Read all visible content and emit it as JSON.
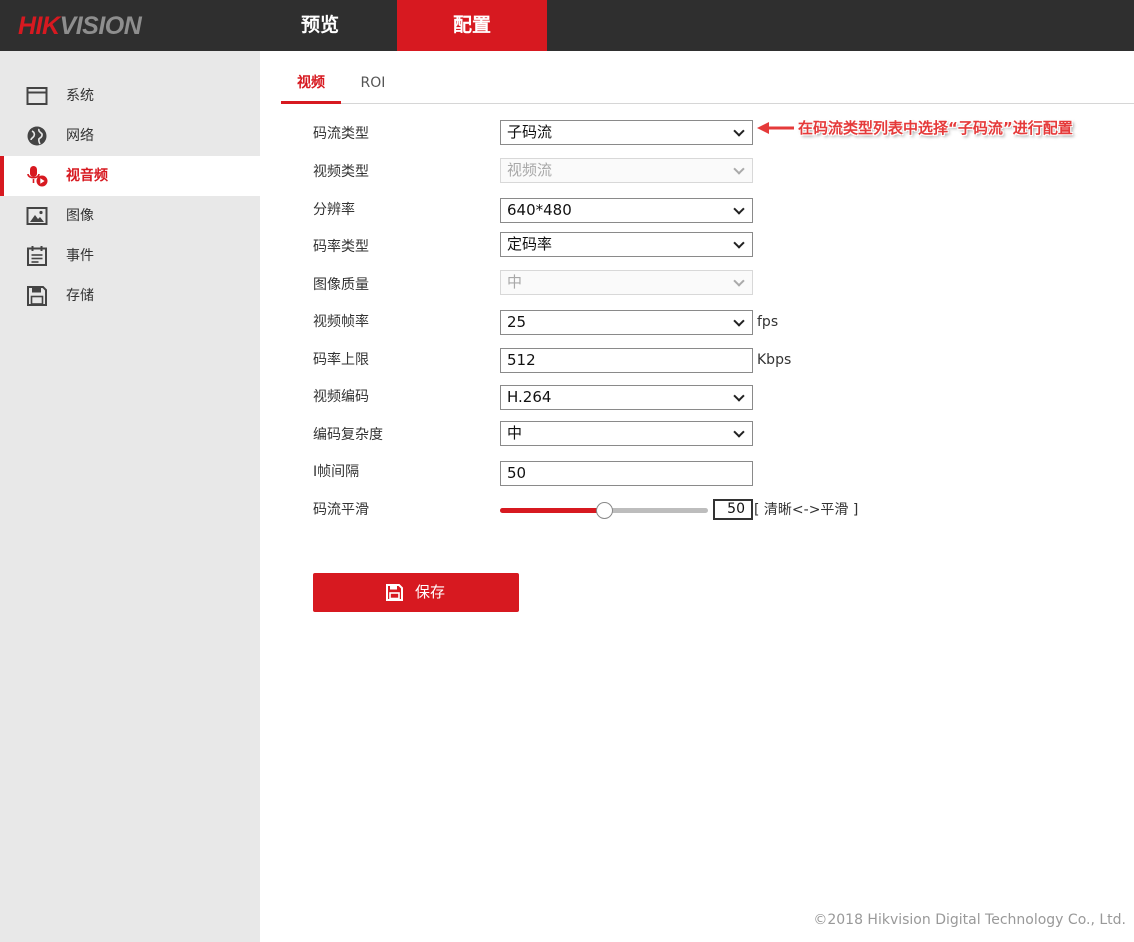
{
  "brand": {
    "logo_red": "HIK",
    "logo_gray": "VISION",
    "accent": "#d71920"
  },
  "top_nav": {
    "preview": "预览",
    "config": "配置"
  },
  "sidebar": {
    "items": [
      {
        "label": "系统",
        "icon": "window-icon"
      },
      {
        "label": "网络",
        "icon": "globe-icon"
      },
      {
        "label": "视音频",
        "icon": "microphone-icon",
        "active": true
      },
      {
        "label": "图像",
        "icon": "image-icon"
      },
      {
        "label": "事件",
        "icon": "calendar-icon"
      },
      {
        "label": "存储",
        "icon": "floppy-disk-icon"
      }
    ]
  },
  "subtabs": {
    "video": "视频",
    "roi": "ROI"
  },
  "form": {
    "stream_type": {
      "label": "码流类型",
      "value": "子码流"
    },
    "video_type": {
      "label": "视频类型",
      "value": "视频流",
      "disabled": true
    },
    "resolution": {
      "label": "分辨率",
      "value": "640*480"
    },
    "bitrate_type": {
      "label": "码率类型",
      "value": "定码率"
    },
    "image_quality": {
      "label": "图像质量",
      "value": "中",
      "disabled": true
    },
    "frame_rate": {
      "label": "视频帧率",
      "value": "25",
      "unit": "fps"
    },
    "bitrate_max": {
      "label": "码率上限",
      "value": "512",
      "unit": "Kbps"
    },
    "video_encoding": {
      "label": "视频编码",
      "value": "H.264"
    },
    "encoding_complexity": {
      "label": "编码复杂度",
      "value": "中"
    },
    "i_frame_interval": {
      "label": "I帧间隔",
      "value": "50"
    },
    "smoothing": {
      "label": "码流平滑",
      "value": "50",
      "fraction": 0.5,
      "hint": "[ 清晰<->平滑 ]"
    }
  },
  "save_button": {
    "label": "保存"
  },
  "annotation": {
    "text": "在码流类型列表中选择“子码流”进行配置",
    "color": "#e53a3a"
  },
  "footer": {
    "text": "©2018 Hikvision Digital Technology Co., Ltd."
  }
}
